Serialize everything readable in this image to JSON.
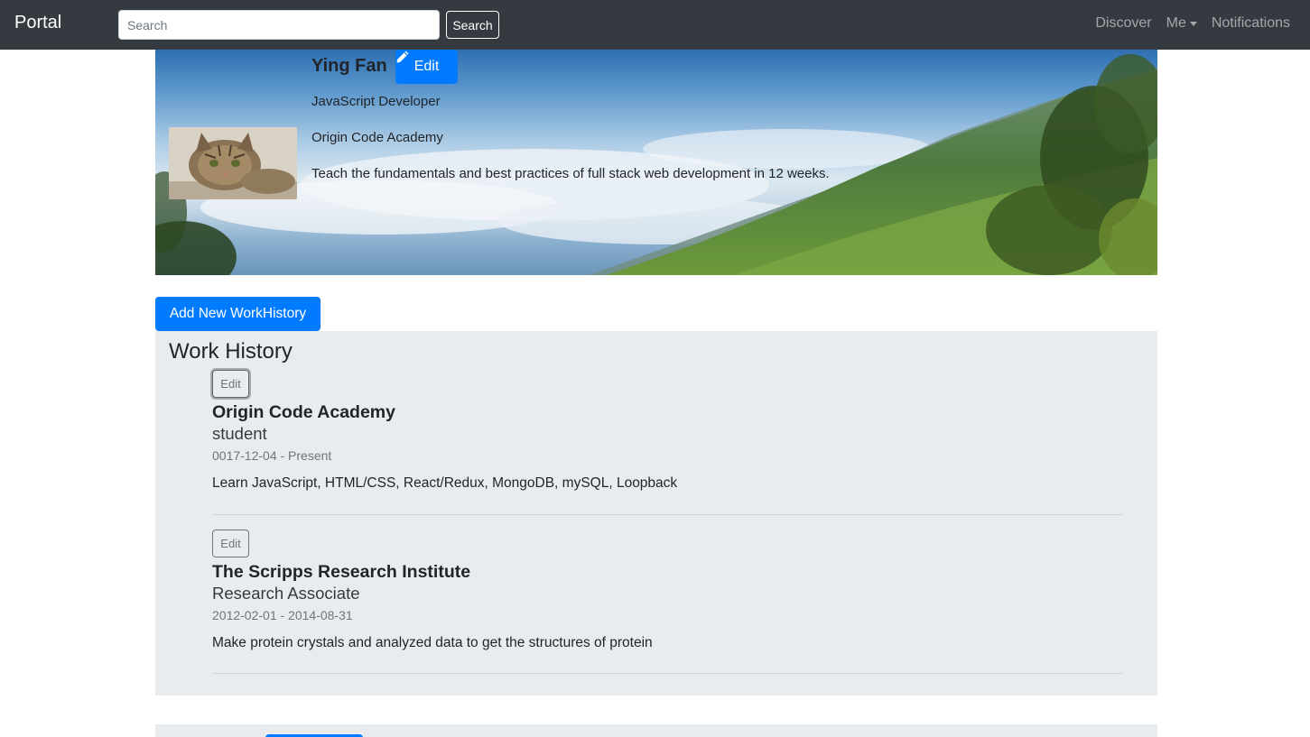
{
  "navbar": {
    "brand": "Portal",
    "search_placeholder": "Search",
    "search_button": "Search",
    "links": [
      "Discover",
      "Me",
      "Notifications"
    ]
  },
  "profile": {
    "name": "Ying Fan",
    "edit_label": "Edit",
    "title": "JavaScript Developer",
    "company": "Origin Code Academy",
    "bio": "Teach the fundamentals and best practices of full stack web development in 12 weeks."
  },
  "add_work_history_label": "Add New WorkHistory",
  "work_history": {
    "title": "Work History",
    "entries": [
      {
        "edit_label": "Edit",
        "company": "Origin Code Academy",
        "role": "student",
        "dates": "0017-12-04 - Present",
        "description": "Learn JavaScript, HTML/CSS, React/Redux, MongoDB, mySQL, Loopback"
      },
      {
        "edit_label": "Edit",
        "company": "The Scripps Research Institute",
        "role": "Research Associate",
        "dates": "2012-02-01 - 2014-08-31",
        "description": "Make protein crystals and analyzed data to get the structures of protein"
      }
    ]
  },
  "colors": {
    "navbar_bg": "#343a40",
    "primary": "#007bff",
    "panel_bg": "#e9ecef"
  },
  "icons": [
    "pencil-icon",
    "caret-down-icon"
  ]
}
